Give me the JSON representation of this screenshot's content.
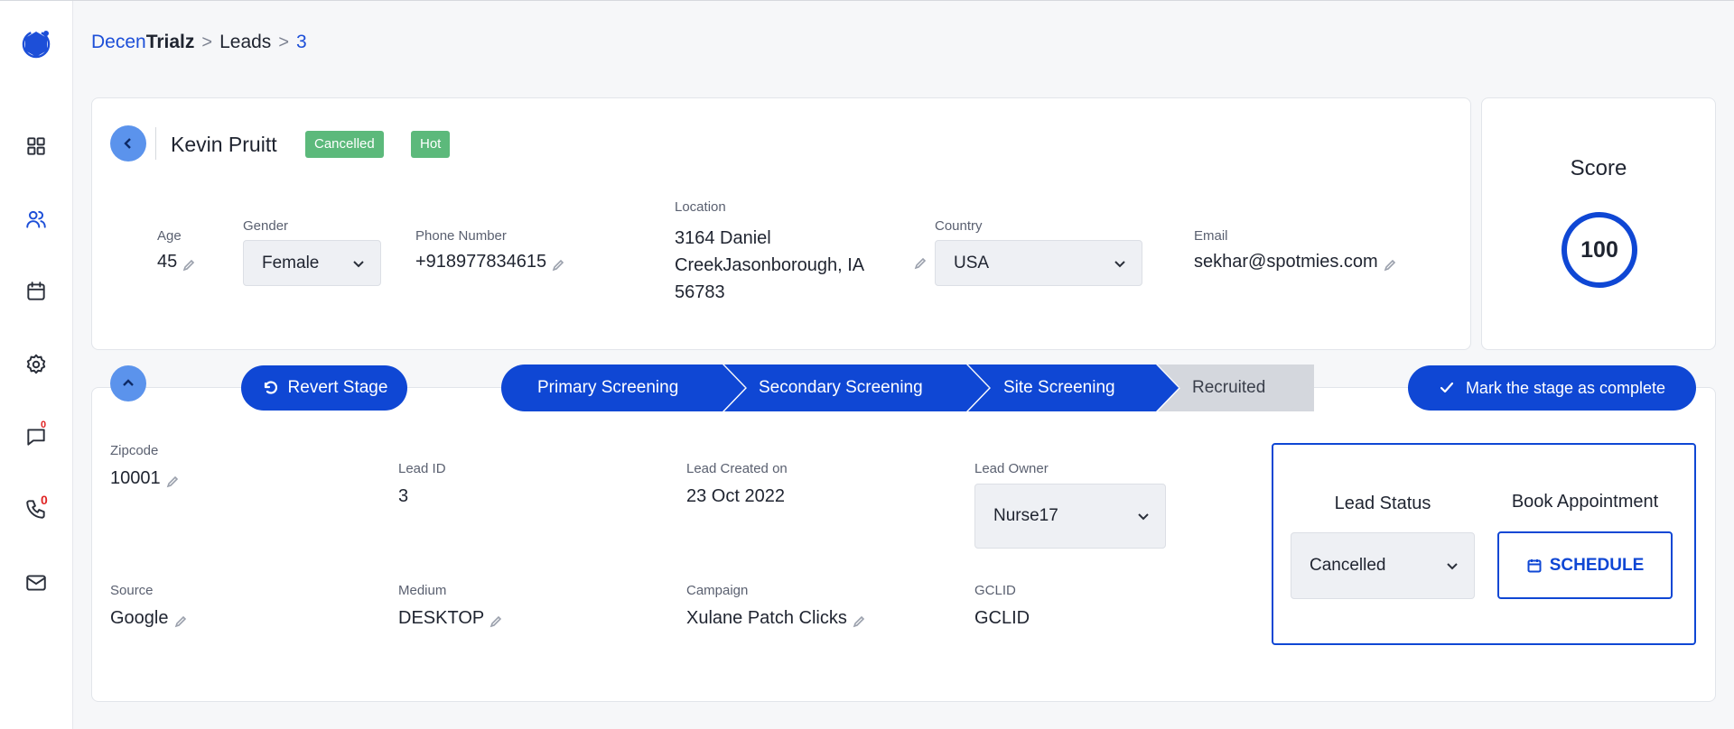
{
  "breadcrumb": {
    "brand_a": "Decen",
    "brand_b": "Trialz",
    "leads": "Leads",
    "id": "3",
    "separator": ">"
  },
  "sidebar": {
    "items": [
      "dashboard-icon",
      "users-icon",
      "calendar-icon",
      "settings-icon",
      "chat-icon",
      "phone-icon",
      "mail-icon"
    ],
    "chat_badge": "0",
    "phone_badge": "0"
  },
  "lead": {
    "name": "Kevin Pruitt",
    "badges": [
      "Cancelled",
      "Hot"
    ],
    "age": {
      "label": "Age",
      "value": "45"
    },
    "gender": {
      "label": "Gender",
      "value": "Female"
    },
    "phone": {
      "label": "Phone Number",
      "value": "+918977834615"
    },
    "location": {
      "label": "Location",
      "line1": "3164 Daniel",
      "line2": "CreekJasonborough, IA",
      "line3": "56783"
    },
    "country": {
      "label": "Country",
      "value": "USA"
    },
    "email": {
      "label": "Email",
      "value": "sekhar@spotmies.com"
    }
  },
  "score": {
    "title": "Score",
    "value": "100"
  },
  "stages": {
    "revert_label": "Revert Stage",
    "items": [
      {
        "label": "Primary Screening",
        "state": "done"
      },
      {
        "label": "Secondary Screening",
        "state": "done"
      },
      {
        "label": "Site Screening",
        "state": "done"
      },
      {
        "label": "Recruited",
        "state": "pending"
      }
    ],
    "complete_label": "Mark the stage as complete"
  },
  "details": {
    "zipcode": {
      "label": "Zipcode",
      "value": "10001"
    },
    "lead_id": {
      "label": "Lead ID",
      "value": "3"
    },
    "created": {
      "label": "Lead Created on",
      "value": "23 Oct 2022"
    },
    "owner": {
      "label": "Lead Owner",
      "value": "Nurse17"
    },
    "source": {
      "label": "Source",
      "value": "Google"
    },
    "medium": {
      "label": "Medium",
      "value": "DESKTOP"
    },
    "campaign": {
      "label": "Campaign",
      "value": "Xulane Patch Clicks"
    },
    "gclid": {
      "label": "GCLID",
      "value": "GCLID"
    }
  },
  "status": {
    "lead_status_label": "Lead Status",
    "lead_status_value": "Cancelled",
    "book_label": "Book Appointment",
    "schedule_label": "SCHEDULE"
  },
  "colors": {
    "primary": "#0f47d4",
    "accent_light": "#5b93ec",
    "success": "#5cb97b",
    "pending": "#d4d7dd",
    "badge_red": "#e02424"
  }
}
